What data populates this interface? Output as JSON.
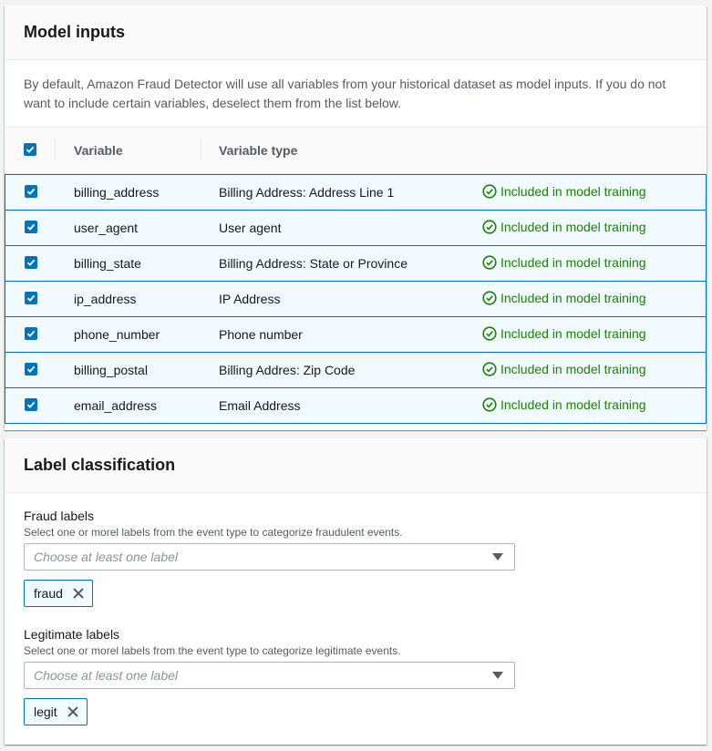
{
  "model_inputs": {
    "title": "Model inputs",
    "description": "By default, Amazon Fraud Detector will use all variables from your historical dataset as model inputs. If you do not want to include certain variables, deselect them from the list below.",
    "columns": {
      "variable": "Variable",
      "variable_type": "Variable type"
    },
    "select_all_checked": true,
    "rows": [
      {
        "variable": "billing_address",
        "type": "Billing Address: Address Line 1",
        "status": "Included in model training",
        "checked": true
      },
      {
        "variable": "user_agent",
        "type": "User agent",
        "status": "Included in model training",
        "checked": true
      },
      {
        "variable": "billing_state",
        "type": "Billing Address: State or Province",
        "status": "Included in model training",
        "checked": true
      },
      {
        "variable": "ip_address",
        "type": "IP Address",
        "status": "Included in model training",
        "checked": true
      },
      {
        "variable": "phone_number",
        "type": "Phone number",
        "status": "Included in model training",
        "checked": true
      },
      {
        "variable": "billing_postal",
        "type": "Billing Addres: Zip Code",
        "status": "Included in model training",
        "checked": true
      },
      {
        "variable": "email_address",
        "type": "Email Address",
        "status": "Included in model training",
        "checked": true
      }
    ],
    "status_icon": "check-circle-icon",
    "colors": {
      "accent": "#0073bb",
      "success": "#1d8102",
      "selected_row_bg": "#f1faff"
    }
  },
  "label_classification": {
    "title": "Label classification",
    "fraud": {
      "label": "Fraud labels",
      "description": "Select one or morel labels from the event type to categorize fraudulent events.",
      "placeholder": "Choose at least one label",
      "tokens": [
        "fraud"
      ]
    },
    "legit": {
      "label": "Legitimate labels",
      "description": "Select one or morel labels from the event type to categorize legitimate events.",
      "placeholder": "Choose at least one label",
      "tokens": [
        "legit"
      ]
    }
  }
}
